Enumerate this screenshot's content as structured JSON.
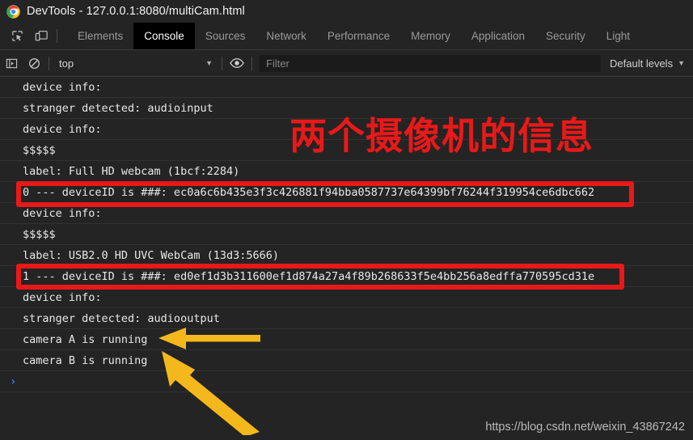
{
  "window": {
    "title": "DevTools - 127.0.0.1:8080/multiCam.html",
    "logo_icon": "chrome-logo-icon"
  },
  "tabbar": {
    "inspect_icon": "inspect-element-icon",
    "device_icon": "device-toolbar-icon",
    "tabs": [
      {
        "label": "Elements",
        "active": false
      },
      {
        "label": "Console",
        "active": true
      },
      {
        "label": "Sources",
        "active": false
      },
      {
        "label": "Network",
        "active": false
      },
      {
        "label": "Performance",
        "active": false
      },
      {
        "label": "Memory",
        "active": false
      },
      {
        "label": "Application",
        "active": false
      },
      {
        "label": "Security",
        "active": false
      },
      {
        "label": "Light",
        "active": false
      }
    ]
  },
  "console_toolbar": {
    "sidebar_icon": "console-sidebar-icon",
    "clear_icon": "clear-console-icon",
    "context": "top",
    "context_caret": "▼",
    "eye_icon": "live-expression-eye-icon",
    "filter_placeholder": "Filter",
    "filter_value": "",
    "levels_label": "Default levels",
    "levels_caret": "▼"
  },
  "console_log": {
    "rows": [
      {
        "text": "device info:"
      },
      {
        "text": "stranger detected: audioinput"
      },
      {
        "text": "device info:"
      },
      {
        "text": "$$$$$"
      },
      {
        "text": "label: Full HD webcam (1bcf:2284)"
      },
      {
        "text": "0 --- deviceID is ###: ec0a6c6b435e3f3c426881f94bba0587737e64399bf76244f319954ce6dbc662"
      },
      {
        "text": "device info:"
      },
      {
        "text": "$$$$$"
      },
      {
        "text": "label: USB2.0 HD UVC WebCam (13d3:5666)"
      },
      {
        "text": "1 --- deviceID is ###: ed0ef1d3b311600ef1d874a27a4f89b268633f5e4bb256a8edffa770595cd31e"
      },
      {
        "text": "device info:"
      },
      {
        "text": "stranger detected: audiooutput"
      },
      {
        "text": "camera A is running"
      },
      {
        "text": "camera B is running"
      }
    ],
    "prompt_symbol": "›"
  },
  "annotations": {
    "chinese_note": "两个摄像机的信息",
    "note_color": "#e81919",
    "highlight_color": "#e81919",
    "arrow_color": "#f5b81c",
    "arrow_a_name": "arrow-pointing-camera-a",
    "arrow_b_name": "arrow-pointing-camera-b"
  },
  "watermark": {
    "text": "https://blog.csdn.net/weixin_43867242"
  }
}
